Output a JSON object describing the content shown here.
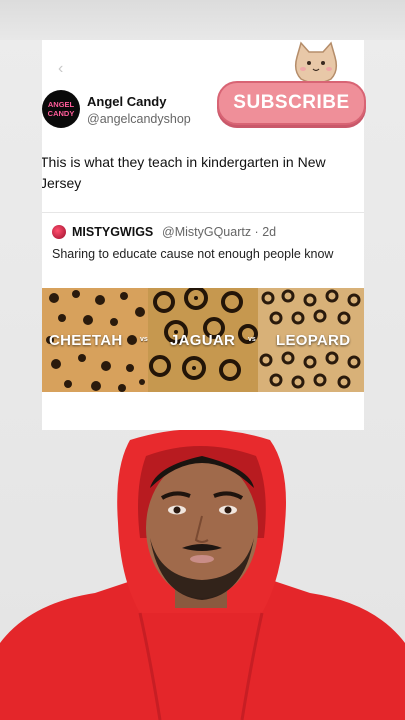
{
  "tweet": {
    "author_name": "Angel Candy",
    "author_handle": "@angelcandyshop",
    "avatar_text_line1": "ANGEL",
    "avatar_text_line2": "CANDY",
    "text": "This is what they teach in kindergarten in New Jersey"
  },
  "quote": {
    "name": "MISTYGWIGS",
    "handle_time": "@MistyGQuartz · 2d",
    "text": "Sharing to educate cause not enough people know",
    "cats": [
      {
        "label": "CHEETAH"
      },
      {
        "label": "JAGUAR"
      },
      {
        "label": "LEOPARD"
      }
    ],
    "vs": "vs"
  },
  "subscribe": {
    "label": "SUBSCRIBE"
  },
  "colors": {
    "hoodie": "#e8282b",
    "subscribe_pink": "#ef8f99",
    "brand_pink": "#ff5c9a"
  }
}
